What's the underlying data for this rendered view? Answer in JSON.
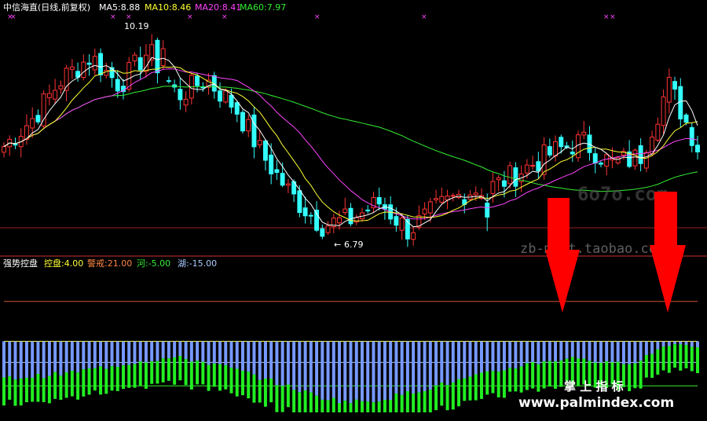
{
  "main_panel": {
    "title": "中信海直(日线,前复权)",
    "ma_labels": [
      {
        "text": "MA5:8.88",
        "color": "#ffffff"
      },
      {
        "text": "MA10:8.46",
        "color": "#ffff33"
      },
      {
        "text": "MA20:8.41",
        "color": "#ff44ff"
      },
      {
        "text": "MA60:7.97",
        "color": "#33ee33"
      }
    ],
    "high_label": "10.19",
    "low_label": "6.79",
    "price_range": [
      6.5,
      10.6
    ]
  },
  "indicator_panel": {
    "title": "强势控盘",
    "labels": [
      {
        "text": "控盘:4.00",
        "color": "#ffff33"
      },
      {
        "text": "警戒:21.00",
        "color": "#ff8844"
      },
      {
        "text": "河:-5.00",
        "color": "#33ee33"
      },
      {
        "text": "湖:-15.00",
        "color": "#aaccff"
      }
    ],
    "levels": {
      "jingjie": 21,
      "kongpan": 4,
      "he": -5,
      "hu": -15
    },
    "value_range": [
      -28,
      34
    ]
  },
  "watermarks": {
    "top": "6o7o.com",
    "middle": "zb-mart.taobao.com",
    "bottom_title": "掌 上 指 标",
    "bottom_url": "www.palmindex.com"
  },
  "colors": {
    "up": "#ff3333",
    "down": "#33ffff",
    "ma5": "#ffffff",
    "ma10": "#ffff33",
    "ma20": "#ff44ff",
    "ma60": "#33ee33",
    "grid": "#992222",
    "bar_blue": "#7799ff",
    "bar_green": "#22ee22",
    "bar_red": "#ff2222",
    "arrow": "#ff0000"
  },
  "chart_data": [
    {
      "type": "candlestick",
      "title": "中信海直(日线,前复权)",
      "high": 10.19,
      "low": 6.79,
      "close_points": [
        8.3,
        8.8,
        9.5,
        9.9,
        9.4,
        10.0,
        9.2,
        9.5,
        9.0,
        8.1,
        7.4,
        6.9,
        7.0,
        7.3,
        6.8,
        7.2,
        7.5,
        7.6,
        7.9,
        8.2,
        8.4,
        8.0,
        8.1,
        9.4,
        8.3
      ]
    },
    {
      "type": "bar",
      "title": "强势控盘",
      "series": [
        {
          "name": "控盘",
          "values": [
            -12,
            -11,
            -10,
            -8,
            -6,
            -4,
            -3,
            -5,
            -8,
            -12,
            -16,
            -20,
            -22,
            -21,
            -18,
            -15,
            -12,
            -9,
            -6,
            -4,
            -3,
            -6,
            -4,
            3,
            2
          ]
        }
      ]
    }
  ]
}
